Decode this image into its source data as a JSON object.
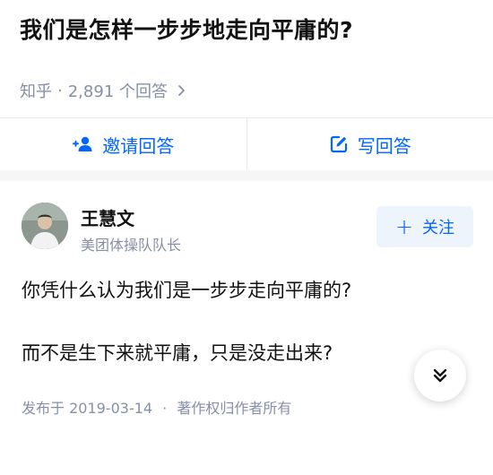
{
  "question": {
    "title": "我们是怎样一步步地走向平庸的?",
    "source": "知乎",
    "separator": "·",
    "answer_count": "2,891 个回答"
  },
  "actions": {
    "invite_label": "邀请回答",
    "write_label": "写回答"
  },
  "answer": {
    "author_name": "王慧文",
    "author_bio": "美团体操队队长",
    "follow_plus": "+",
    "follow_label": "关注",
    "paragraphs": [
      "你凭什么认为我们是一步步走向平庸的?",
      "而不是生下来就平庸，只是没走出来?"
    ],
    "publish_date": "发布于 2019-03-14",
    "separator": "·",
    "copyright": "著作权归作者所有"
  },
  "colors": {
    "accent": "#0066ff",
    "muted": "#8590a6",
    "text": "#121212",
    "follow_bg": "#eef4fb"
  },
  "icons": {
    "invite": "add-person-icon",
    "write": "edit-icon",
    "chevron": "chevron-right-icon",
    "expand": "double-chevron-down-icon"
  }
}
